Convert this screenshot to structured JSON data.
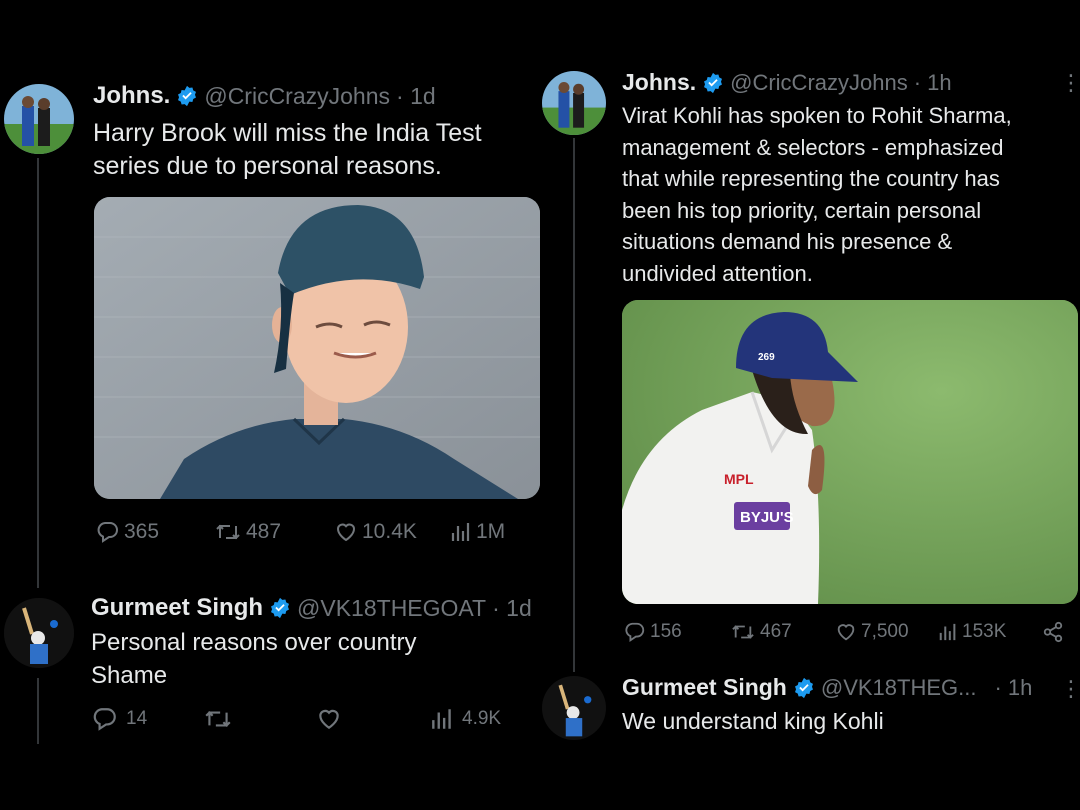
{
  "left_tweet": {
    "name": "Johns.",
    "handle": "@CricCrazyJohns",
    "time": "· 1d",
    "text_lines": [
      "Harry Brook will miss the India Test",
      "series due to personal reasons."
    ],
    "stats": {
      "replies": "365",
      "reposts": "487",
      "likes": "10.4K",
      "views": "1M"
    }
  },
  "left_reply": {
    "name": "Gurmeet Singh",
    "handle": "@VK18THEGOAT",
    "time": "· 1d",
    "text_lines": [
      "Personal reasons over country",
      "Shame"
    ],
    "stats": {
      "replies": "14",
      "views": "4.9K"
    }
  },
  "right_tweet": {
    "name": "Johns.",
    "handle": "@CricCrazyJohns",
    "time": "· 1h",
    "text_lines": [
      "Virat Kohli has spoken to Rohit Sharma,",
      "management & selectors - emphasized",
      "that while representing the country has",
      "been his top priority, certain personal",
      "situations demand his presence &",
      "undivided attention."
    ],
    "stats": {
      "replies": "156",
      "reposts": "467",
      "likes": "7,500",
      "views": "153K"
    }
  },
  "right_reply": {
    "name": "Gurmeet Singh",
    "handle": "@VK18THEG...",
    "time": "· 1h",
    "text_lines": [
      "We understand king Kohli"
    ]
  },
  "image_text": {
    "cap_number": "269",
    "shirt_logo": "MPL",
    "shirt_sponsor": "BYJU'S"
  },
  "colors": {
    "background": "#000000",
    "text": "#e7e9ea",
    "muted": "#71767b",
    "verified": "#1d9bf0"
  },
  "icons": [
    "reply-icon",
    "repost-icon",
    "like-icon",
    "views-icon",
    "share-icon",
    "more-icon",
    "verified-badge-icon"
  ]
}
